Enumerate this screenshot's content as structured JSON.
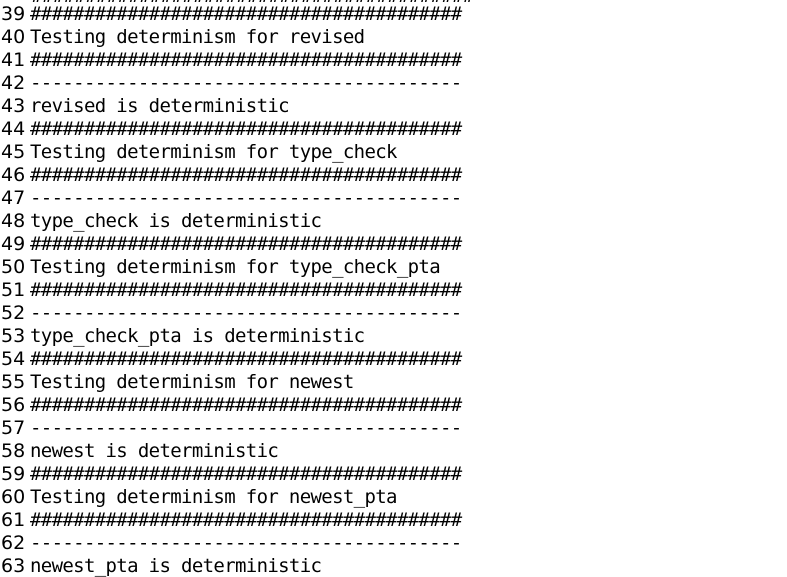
{
  "partial_top": "#########################################",
  "lines": [
    {
      "n": "39",
      "text": "########################################"
    },
    {
      "n": "40",
      "text": "Testing determinism for revised"
    },
    {
      "n": "41",
      "text": "########################################"
    },
    {
      "n": "42",
      "text": "----------------------------------------"
    },
    {
      "n": "43",
      "text": "revised is deterministic"
    },
    {
      "n": "44",
      "text": "########################################"
    },
    {
      "n": "45",
      "text": "Testing determinism for type_check"
    },
    {
      "n": "46",
      "text": "########################################"
    },
    {
      "n": "47",
      "text": "----------------------------------------"
    },
    {
      "n": "48",
      "text": "type_check is deterministic"
    },
    {
      "n": "49",
      "text": "########################################"
    },
    {
      "n": "50",
      "text": "Testing determinism for type_check_pta"
    },
    {
      "n": "51",
      "text": "########################################"
    },
    {
      "n": "52",
      "text": "----------------------------------------"
    },
    {
      "n": "53",
      "text": "type_check_pta is deterministic"
    },
    {
      "n": "54",
      "text": "########################################"
    },
    {
      "n": "55",
      "text": "Testing determinism for newest"
    },
    {
      "n": "56",
      "text": "########################################"
    },
    {
      "n": "57",
      "text": "----------------------------------------"
    },
    {
      "n": "58",
      "text": "newest is deterministic"
    },
    {
      "n": "59",
      "text": "########################################"
    },
    {
      "n": "60",
      "text": "Testing determinism for newest_pta"
    },
    {
      "n": "61",
      "text": "########################################"
    },
    {
      "n": "62",
      "text": "----------------------------------------"
    },
    {
      "n": "63",
      "text": "newest_pta is deterministic"
    }
  ]
}
